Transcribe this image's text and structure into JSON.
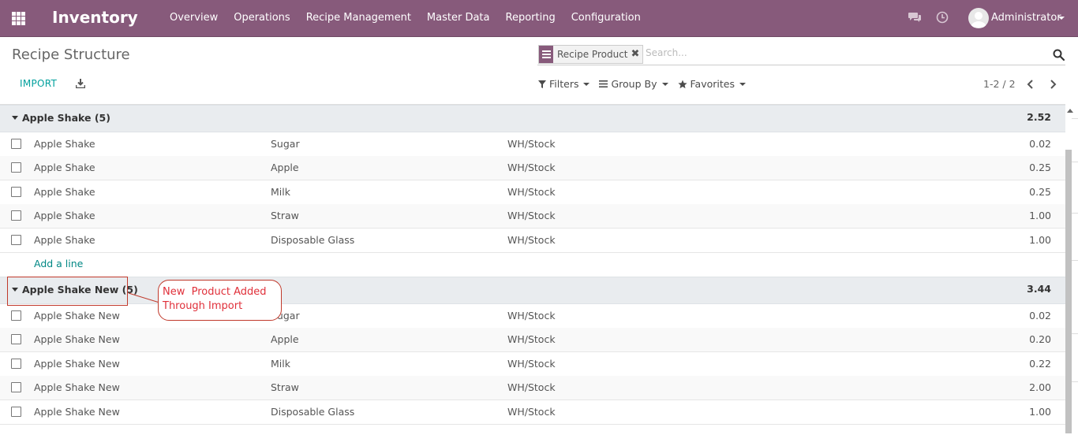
{
  "navbar": {
    "app_name": "Inventory",
    "menu": [
      "Overview",
      "Operations",
      "Recipe Management",
      "Master Data",
      "Reporting",
      "Configuration"
    ],
    "user": "Administrator",
    "icons": [
      "apps-grid-icon",
      "chat-icon",
      "clock-icon",
      "user-avatar"
    ],
    "color": "#875a7b"
  },
  "control_panel": {
    "title": "Recipe Structure",
    "facet_label": "Recipe Product",
    "facet_remove": "✖",
    "search_placeholder": "Search...",
    "import_label": "IMPORT",
    "filters_label": "Filters",
    "groupby_label": "Group By",
    "favorites_label": "Favorites",
    "pager": "1-2 / 2",
    "accent": "#00a09d"
  },
  "groups": [
    {
      "name": "Apple Shake (5)",
      "total": "2.52",
      "rows": [
        {
          "product": "Apple Shake",
          "component": "Sugar",
          "location": "WH/Stock",
          "qty": "0.02"
        },
        {
          "product": "Apple Shake",
          "component": "Apple",
          "location": "WH/Stock",
          "qty": "0.25"
        },
        {
          "product": "Apple Shake",
          "component": "Milk",
          "location": "WH/Stock",
          "qty": "0.25"
        },
        {
          "product": "Apple Shake",
          "component": "Straw",
          "location": "WH/Stock",
          "qty": "1.00"
        },
        {
          "product": "Apple Shake",
          "component": "Disposable Glass",
          "location": "WH/Stock",
          "qty": "1.00"
        }
      ],
      "add_line": "Add a line"
    },
    {
      "name": "Apple Shake New (5)",
      "total": "3.44",
      "rows": [
        {
          "product": "Apple Shake New",
          "component": "Sugar",
          "location": "WH/Stock",
          "qty": "0.02"
        },
        {
          "product": "Apple Shake New",
          "component": "Apple",
          "location": "WH/Stock",
          "qty": "0.20"
        },
        {
          "product": "Apple Shake New",
          "component": "Milk",
          "location": "WH/Stock",
          "qty": "0.22"
        },
        {
          "product": "Apple Shake New",
          "component": "Straw",
          "location": "WH/Stock",
          "qty": "2.00"
        },
        {
          "product": "Apple Shake New",
          "component": "Disposable Glass",
          "location": "WH/Stock",
          "qty": "1.00"
        }
      ]
    }
  ],
  "annotation": {
    "text": "New  Product Added\nThrough Import",
    "color": "#e0303a"
  }
}
